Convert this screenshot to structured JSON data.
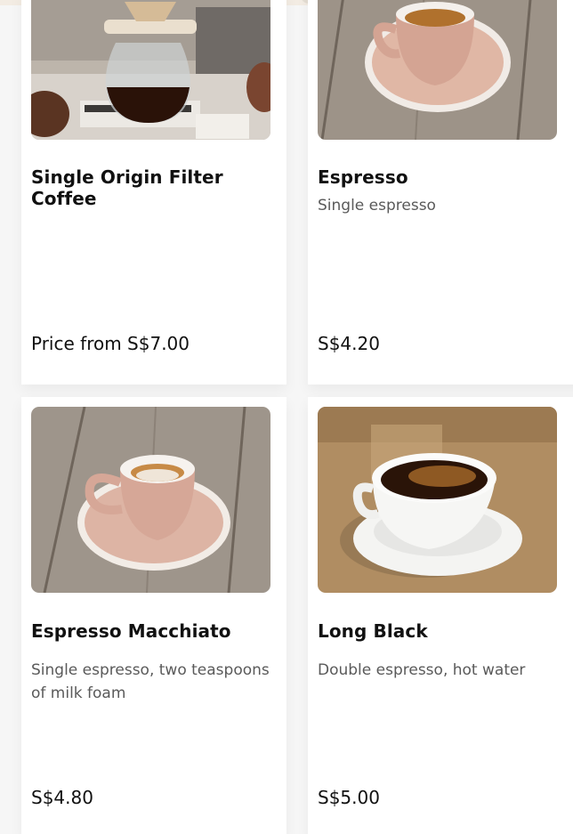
{
  "menu": {
    "items": [
      {
        "name": "Single Origin Filter Coffee",
        "description": "",
        "price": "Price from S$7.00",
        "image_icon": "pour-over-coffee-image"
      },
      {
        "name": "Espresso",
        "description": "Single espresso",
        "price": "S$4.20",
        "image_icon": "espresso-cup-image"
      },
      {
        "name": "Espresso Macchiato",
        "description": "Single espresso, two teaspoons of milk foam",
        "price": "S$4.80",
        "image_icon": "macchiato-cup-image"
      },
      {
        "name": "Long Black",
        "description": "Double espresso, hot water",
        "price": "S$5.00",
        "image_icon": "long-black-cup-image"
      }
    ]
  },
  "colors": {
    "card_background": "#ffffff",
    "page_background": "#f6f6f6",
    "title_text": "#111111",
    "description_text": "#5a5a5a",
    "active_tab": "#2c3436",
    "inactive_tab": "#e4ddd3"
  }
}
